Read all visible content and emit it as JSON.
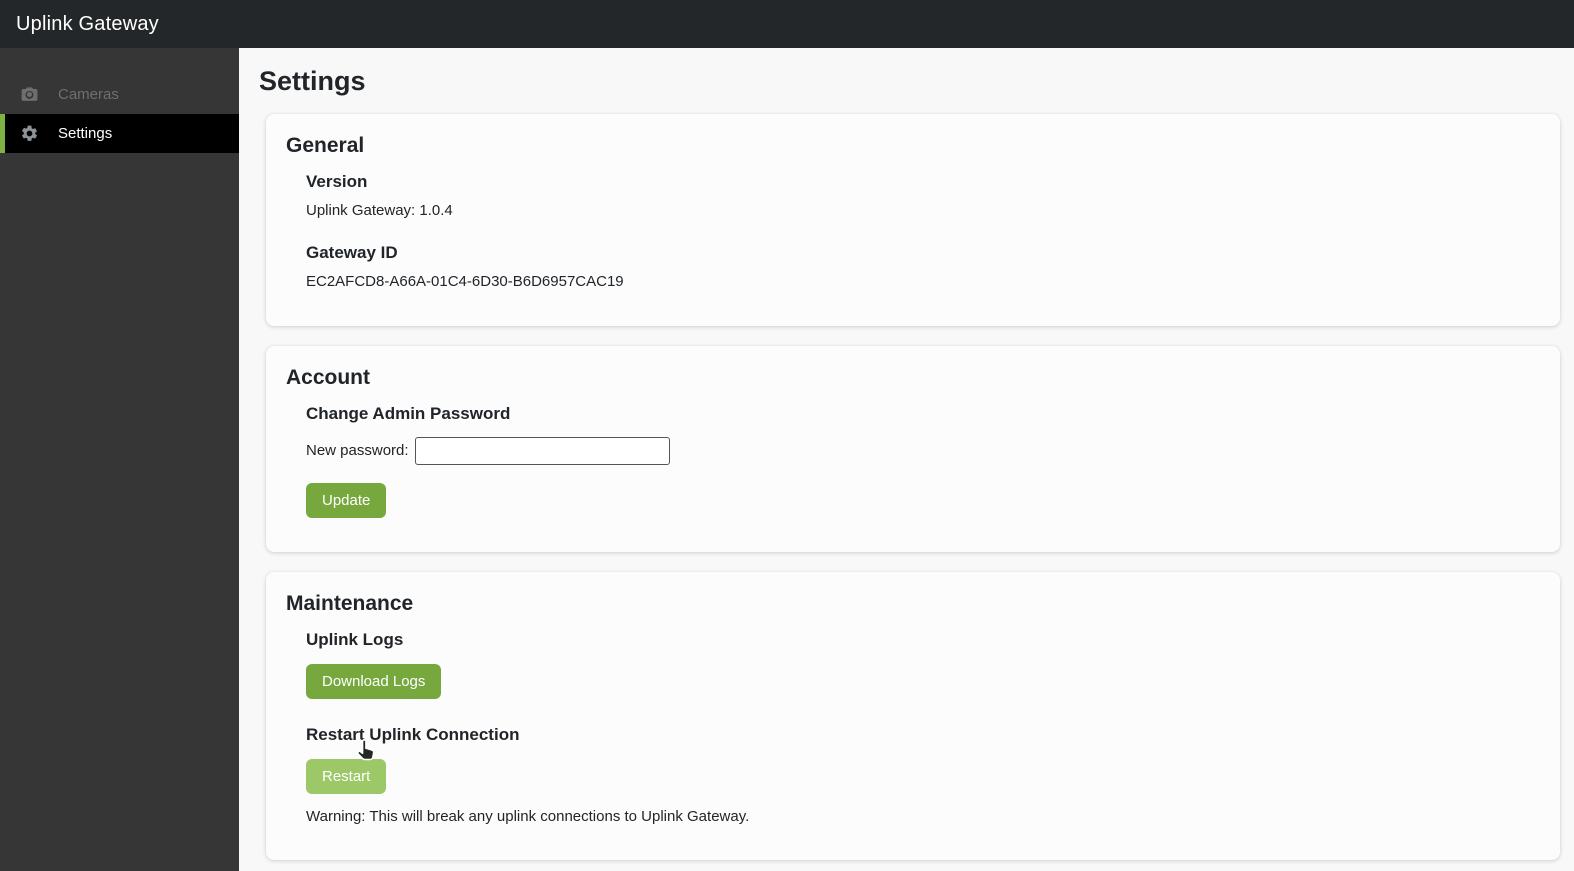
{
  "topbar": {
    "title": "Uplink Gateway"
  },
  "sidebar": {
    "items": [
      {
        "label": "Cameras",
        "icon": "camera-icon",
        "active": false
      },
      {
        "label": "Settings",
        "icon": "gear-icon",
        "active": true
      }
    ]
  },
  "main": {
    "title": "Settings"
  },
  "general": {
    "title": "General",
    "version": {
      "label": "Version",
      "value": "Uplink Gateway: 1.0.4"
    },
    "gateway_id": {
      "label": "Gateway ID",
      "value": "EC2AFCD8-A66A-01C4-6D30-B6D6957CAC19"
    }
  },
  "account": {
    "title": "Account",
    "change_password_label": "Change Admin Password",
    "new_password_label": "New password:",
    "new_password_value": "",
    "update_button": "Update"
  },
  "maintenance": {
    "title": "Maintenance",
    "uplink_logs_label": "Uplink Logs",
    "download_logs_button": "Download Logs",
    "restart_label": "Restart Uplink Connection",
    "restart_button": "Restart",
    "warning": "Warning: This will break any uplink connections to Uplink Gateway."
  },
  "colors": {
    "accent_green": "#7db343",
    "button_green": "#76a83e",
    "button_green_hover": "#9cc868",
    "topbar_bg": "#24272a",
    "sidebar_bg": "#363636",
    "active_item_bg": "#000000"
  }
}
